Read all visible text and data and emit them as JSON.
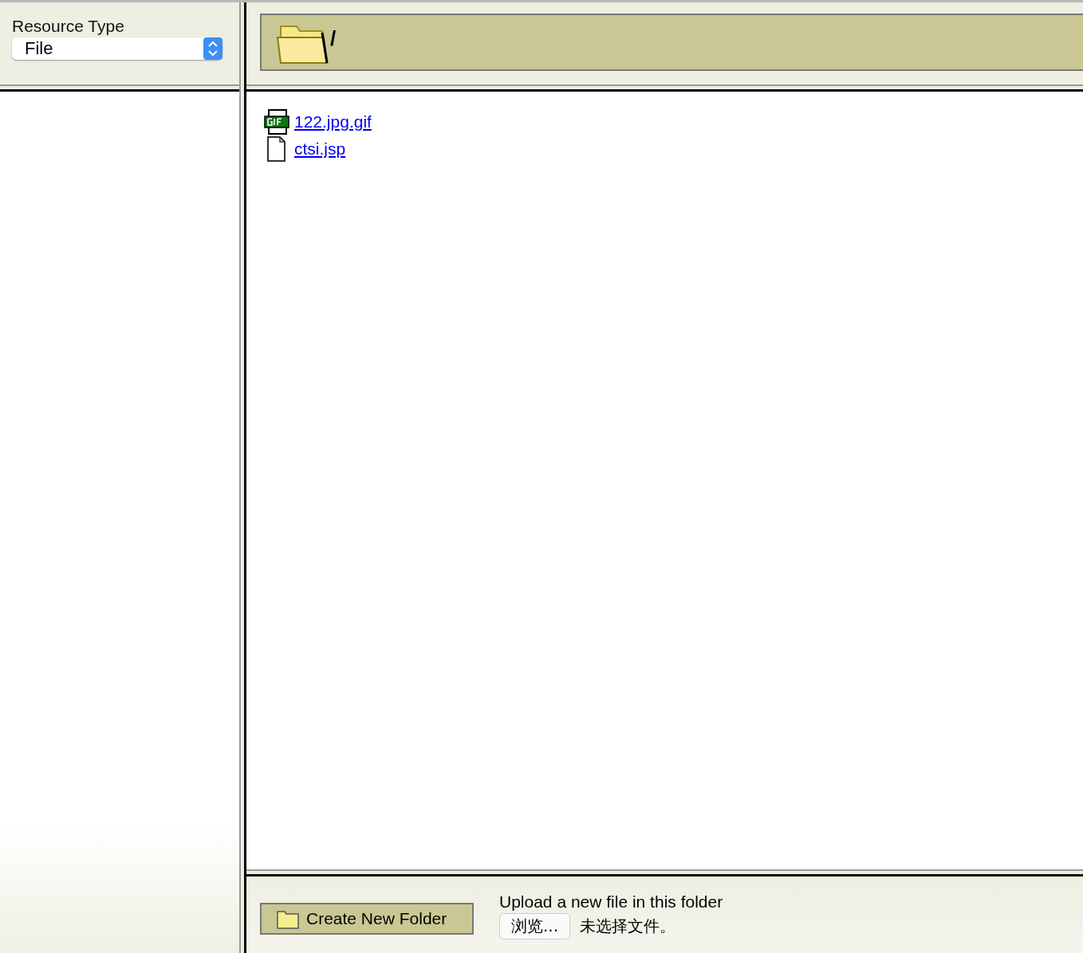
{
  "resource_type": {
    "label": "Resource Type",
    "value": "File"
  },
  "current_folder": {
    "path": "/"
  },
  "files": [
    {
      "name": "122.jpg.gif",
      "kind": "gif"
    },
    {
      "name": "ctsi.jsp",
      "kind": "generic"
    }
  ],
  "create_folder_button": {
    "label": "Create New Folder"
  },
  "upload": {
    "label": "Upload a new file in this folder",
    "browse_button": "浏览...",
    "file_status": "未选择文件。"
  }
}
